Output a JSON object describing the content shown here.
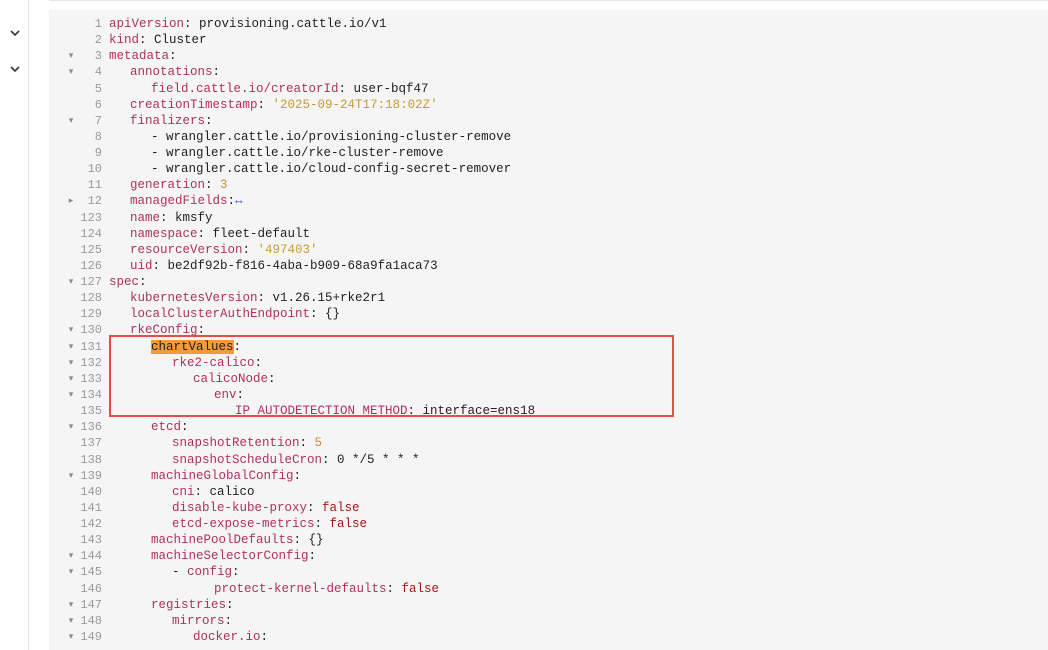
{
  "left_rail": {
    "chevrons": [
      "chevron-down-icon",
      "chevron-down-icon"
    ]
  },
  "colors": {
    "key": "#b03060",
    "string": "#c99a32",
    "number": "#c98b3a",
    "boolean": "#a31515",
    "line_number": "#9a9a9a",
    "search_highlight": "#f59a38",
    "annotation_box": "#e74c4c"
  },
  "lines": [
    {
      "n": "1",
      "fold": "",
      "ind": 0,
      "key": "apiVersion",
      "sep": ": ",
      "val": "provisioning.cattle.io/v1",
      "vt": "p"
    },
    {
      "n": "2",
      "fold": "",
      "ind": 0,
      "key": "kind",
      "sep": ": ",
      "val": "Cluster",
      "vt": "p"
    },
    {
      "n": "3",
      "fold": "▾",
      "ind": 0,
      "key": "metadata",
      "sep": ":",
      "val": "",
      "vt": "p"
    },
    {
      "n": "4",
      "fold": "▾",
      "ind": 1,
      "key": "annotations",
      "sep": ":",
      "val": "",
      "vt": "p"
    },
    {
      "n": "5",
      "fold": "",
      "ind": 2,
      "key": "field.cattle.io/creatorId",
      "sep": ": ",
      "val": "user-bqf47",
      "vt": "p"
    },
    {
      "n": "6",
      "fold": "",
      "ind": 1,
      "key": "creationTimestamp",
      "sep": ": ",
      "val": "'2025-09-24T17:18:02Z'",
      "vt": "s"
    },
    {
      "n": "7",
      "fold": "▾",
      "ind": 1,
      "key": "finalizers",
      "sep": ":",
      "val": "",
      "vt": "p"
    },
    {
      "n": "8",
      "fold": "",
      "ind": 2,
      "key": "",
      "sep": "- ",
      "val": "wrangler.cattle.io/provisioning-cluster-remove",
      "vt": "p"
    },
    {
      "n": "9",
      "fold": "",
      "ind": 2,
      "key": "",
      "sep": "- ",
      "val": "wrangler.cattle.io/rke-cluster-remove",
      "vt": "p"
    },
    {
      "n": "10",
      "fold": "",
      "ind": 2,
      "key": "",
      "sep": "- ",
      "val": "wrangler.cattle.io/cloud-config-secret-remover",
      "vt": "p"
    },
    {
      "n": "11",
      "fold": "",
      "ind": 1,
      "key": "generation",
      "sep": ": ",
      "val": "3",
      "vt": "n"
    },
    {
      "n": "12",
      "fold": "▸",
      "ind": 1,
      "key": "managedFields",
      "sep": ":",
      "val": "↔",
      "vt": "m"
    },
    {
      "n": "123",
      "fold": "",
      "ind": 1,
      "key": "name",
      "sep": ": ",
      "val": "kmsfy",
      "vt": "p"
    },
    {
      "n": "124",
      "fold": "",
      "ind": 1,
      "key": "namespace",
      "sep": ": ",
      "val": "fleet-default",
      "vt": "p"
    },
    {
      "n": "125",
      "fold": "",
      "ind": 1,
      "key": "resourceVersion",
      "sep": ": ",
      "val": "'497403'",
      "vt": "s"
    },
    {
      "n": "126",
      "fold": "",
      "ind": 1,
      "key": "uid",
      "sep": ": ",
      "val": "be2df92b-f816-4aba-b909-68a9fa1aca73",
      "vt": "p"
    },
    {
      "n": "127",
      "fold": "▾",
      "ind": 0,
      "key": "spec",
      "sep": ":",
      "val": "",
      "vt": "p"
    },
    {
      "n": "128",
      "fold": "",
      "ind": 1,
      "key": "kubernetesVersion",
      "sep": ": ",
      "val": "v1.26.15+rke2r1",
      "vt": "p"
    },
    {
      "n": "129",
      "fold": "",
      "ind": 1,
      "key": "localClusterAuthEndpoint",
      "sep": ": ",
      "val": "{}",
      "vt": "p"
    },
    {
      "n": "130",
      "fold": "▾",
      "ind": 1,
      "key": "rkeConfig",
      "sep": ":",
      "val": "",
      "vt": "p"
    },
    {
      "n": "131",
      "fold": "▾",
      "ind": 2,
      "key": "chartValues",
      "sep": ":",
      "val": "",
      "vt": "p",
      "hl": true
    },
    {
      "n": "132",
      "fold": "▾",
      "ind": 3,
      "key": "rke2-calico",
      "sep": ":",
      "val": "",
      "vt": "p"
    },
    {
      "n": "133",
      "fold": "▾",
      "ind": 4,
      "key": "calicoNode",
      "sep": ":",
      "val": "",
      "vt": "p"
    },
    {
      "n": "134",
      "fold": "▾",
      "ind": 5,
      "key": "env",
      "sep": ":",
      "val": "",
      "vt": "p"
    },
    {
      "n": "135",
      "fold": "",
      "ind": 6,
      "key": "IP_AUTODETECTION_METHOD",
      "sep": ": ",
      "val": "interface=ens18",
      "vt": "p"
    },
    {
      "n": "136",
      "fold": "▾",
      "ind": 2,
      "key": "etcd",
      "sep": ":",
      "val": "",
      "vt": "p"
    },
    {
      "n": "137",
      "fold": "",
      "ind": 3,
      "key": "snapshotRetention",
      "sep": ": ",
      "val": "5",
      "vt": "n"
    },
    {
      "n": "138",
      "fold": "",
      "ind": 3,
      "key": "snapshotScheduleCron",
      "sep": ": ",
      "val": "0 */5 * * *",
      "vt": "p"
    },
    {
      "n": "139",
      "fold": "▾",
      "ind": 2,
      "key": "machineGlobalConfig",
      "sep": ":",
      "val": "",
      "vt": "p"
    },
    {
      "n": "140",
      "fold": "",
      "ind": 3,
      "key": "cni",
      "sep": ": ",
      "val": "calico",
      "vt": "p"
    },
    {
      "n": "141",
      "fold": "",
      "ind": 3,
      "key": "disable-kube-proxy",
      "sep": ": ",
      "val": "false",
      "vt": "b"
    },
    {
      "n": "142",
      "fold": "",
      "ind": 3,
      "key": "etcd-expose-metrics",
      "sep": ": ",
      "val": "false",
      "vt": "b"
    },
    {
      "n": "143",
      "fold": "",
      "ind": 2,
      "key": "machinePoolDefaults",
      "sep": ": ",
      "val": "{}",
      "vt": "p"
    },
    {
      "n": "144",
      "fold": "▾",
      "ind": 2,
      "key": "machineSelectorConfig",
      "sep": ":",
      "val": "",
      "vt": "p"
    },
    {
      "n": "145",
      "fold": "▾",
      "ind": 3,
      "key": "config",
      "sep": ":",
      "val": "",
      "vt": "p",
      "dash": true
    },
    {
      "n": "146",
      "fold": "",
      "ind": 5,
      "key": "protect-kernel-defaults",
      "sep": ": ",
      "val": "false",
      "vt": "b"
    },
    {
      "n": "147",
      "fold": "▾",
      "ind": 2,
      "key": "registries",
      "sep": ":",
      "val": "",
      "vt": "p"
    },
    {
      "n": "148",
      "fold": "▾",
      "ind": 3,
      "key": "mirrors",
      "sep": ":",
      "val": "",
      "vt": "p"
    },
    {
      "n": "149",
      "fold": "▾",
      "ind": 4,
      "key": "docker.io",
      "sep": ":",
      "val": "",
      "vt": "p"
    }
  ]
}
